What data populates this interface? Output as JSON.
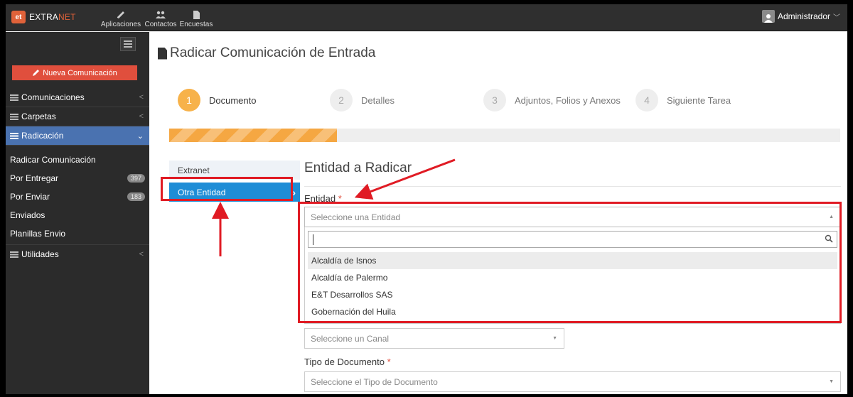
{
  "topbar": {
    "brand_logo": "et",
    "brand_text_a": "EXTRA",
    "brand_text_b": "NET",
    "nav": [
      {
        "label": "Aplicaciones",
        "icon": "pencil-icon"
      },
      {
        "label": "Contactos",
        "icon": "users-icon"
      },
      {
        "label": "Encuestas",
        "icon": "document-icon"
      }
    ],
    "user_name": "Administrador"
  },
  "sidebar": {
    "new_button": "Nueva Comunicación",
    "menu": [
      {
        "label": "Comunicaciones",
        "caret": "<"
      },
      {
        "label": "Carpetas",
        "caret": "<"
      },
      {
        "label": "Radicación",
        "caret": "⌄"
      }
    ],
    "submenu": [
      {
        "label": "Radicar Comunicación",
        "count": ""
      },
      {
        "label": "Por Entregar",
        "count": "397"
      },
      {
        "label": "Por Enviar",
        "count": "183"
      },
      {
        "label": "Enviados",
        "count": ""
      },
      {
        "label": "Planillas Envio",
        "count": ""
      }
    ],
    "utilities": {
      "label": "Utilidades",
      "caret": "<"
    }
  },
  "main": {
    "title": "Radicar Comunicación de Entrada",
    "steps": [
      {
        "number": "1",
        "label": "Documento"
      },
      {
        "number": "2",
        "label": "Detalles"
      },
      {
        "number": "3",
        "label": "Adjuntos, Folios y Anexos"
      },
      {
        "number": "4",
        "label": "Siguiente Tarea"
      }
    ],
    "progress": 0.25,
    "tabs": [
      "Extranet",
      "Otra Entidad"
    ],
    "section_title": "Entidad a Radicar",
    "entity_label": "Entidad",
    "required_mark": "*",
    "entity_placeholder": "Seleccione una Entidad",
    "entity_caret": "▲",
    "entity_options": [
      "Alcaldía de Isnos",
      "Alcaldía de Palermo",
      "E&T Desarrollos SAS",
      "Gobernación del Huila"
    ],
    "channel_placeholder": "Seleccione un Canal",
    "select_caret": "▼",
    "doc_type_label": "Tipo de Documento",
    "doc_type_placeholder": "Seleccione el Tipo de Documento"
  },
  "colors": {
    "accent_red": "#e01b24",
    "progress_orange": "#f5a742",
    "tab_active": "#1f8dd6",
    "menu_active": "#4a72b0"
  }
}
